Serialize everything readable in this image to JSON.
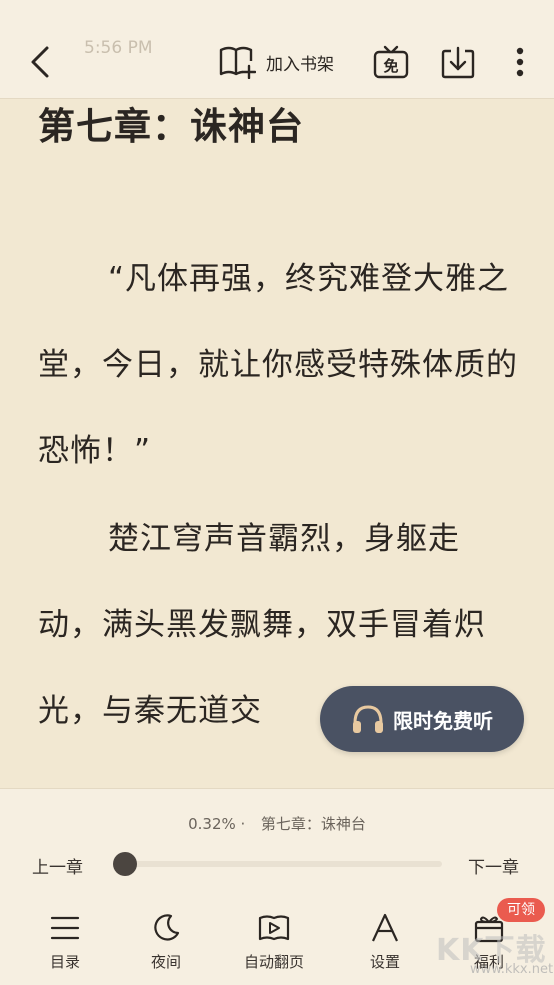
{
  "topbar": {
    "ghost_time": "5:56 PM",
    "shelf_label": "加入书架",
    "free_icon_text": "免"
  },
  "reader": {
    "chapter_title": "第七章：诛神台",
    "paragraphs": [
      "“凡体再强，终究难登大雅之堂，今日，就让你感受特殊体质的恐怖！”",
      "楚江穹声音霸烈，身躯走动，满头黑发飘舞，双手冒着炽光，与秦无道交"
    ]
  },
  "listen_pill": {
    "label": "限时免费听",
    "icon": "headphones-icon"
  },
  "progress": {
    "percent_text": "0.32% ·",
    "chapter_text": "第七章：诛神台",
    "fraction": 0.0032,
    "prev_label": "上一章",
    "next_label": "下一章"
  },
  "tabs": [
    {
      "label": "目录",
      "icon": "list-icon"
    },
    {
      "label": "夜间",
      "icon": "moon-icon"
    },
    {
      "label": "自动翻页",
      "icon": "autoplay-book-icon"
    },
    {
      "label": "设置",
      "icon": "font-a-icon"
    },
    {
      "label": "福利",
      "icon": "gift-icon"
    }
  ],
  "badge": "可领",
  "watermark": {
    "main": "KK下载",
    "sub": "www.kkx.net"
  },
  "colors": {
    "page_bg": "#f2e8d2",
    "bar_bg": "#f6efe1",
    "pill_bg": "#4a5263",
    "badge_bg": "#ea5b4f"
  }
}
